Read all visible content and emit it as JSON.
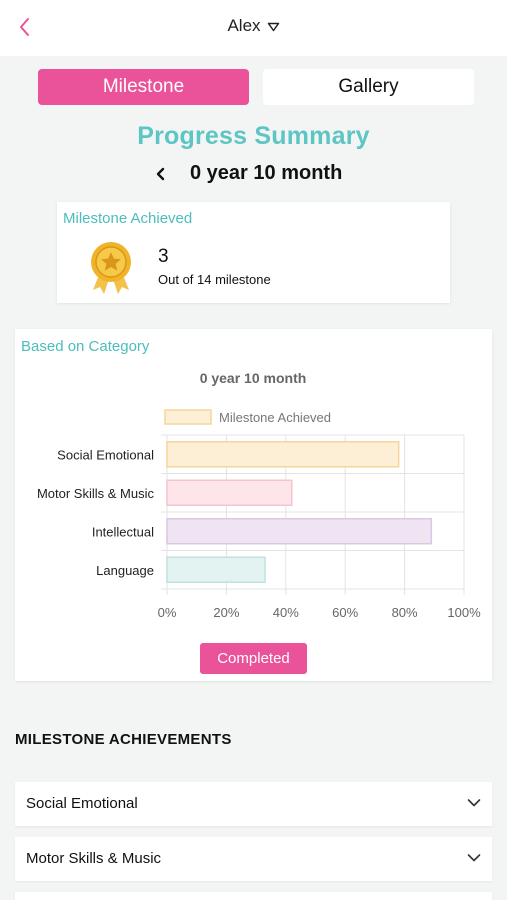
{
  "header": {
    "child_name": "Alex"
  },
  "tabs": [
    {
      "label": "Milestone",
      "active": true
    },
    {
      "label": "Gallery",
      "active": false
    }
  ],
  "summary": {
    "title": "Progress Summary",
    "age_label": "0 year 10 month"
  },
  "achieved_card": {
    "title": "Milestone Achieved",
    "count": "3",
    "subtitle": "Out of 14 milestone"
  },
  "category_card": {
    "title": "Based on Category",
    "completed_label": "Completed"
  },
  "chart_data": {
    "type": "bar",
    "orientation": "horizontal",
    "title": "0 year 10 month",
    "categories": [
      "Social Emotional",
      "Motor Skills & Music",
      "Intellectual",
      "Language"
    ],
    "series": [
      {
        "name": "Milestone Achieved",
        "values": [
          78,
          42,
          89,
          33
        ],
        "fill_colors": [
          "#fdefd5",
          "#fde5ea",
          "#efe4f2",
          "#e3f3f2"
        ],
        "stroke_colors": [
          "#f5d59c",
          "#f6c4cf",
          "#dbc7e4",
          "#bfe1df"
        ]
      }
    ],
    "xlim": [
      0,
      100
    ],
    "x_ticks": [
      "0%",
      "20%",
      "40%",
      "60%",
      "80%",
      "100%"
    ],
    "grid": true,
    "legend": "top-center"
  },
  "achievements": {
    "heading": "MILESTONE ACHIEVEMENTS",
    "items": [
      "Social Emotional",
      "Motor Skills & Music"
    ]
  },
  "colors": {
    "accent": "#ea5299",
    "teal": "#5dc5c4",
    "background": "#f3f5f5"
  },
  "icons": {
    "back": "chevron-left-icon",
    "medal": "medal-icon",
    "dropdown": "triangle-down-icon",
    "accordion": "chevron-down-icon"
  }
}
